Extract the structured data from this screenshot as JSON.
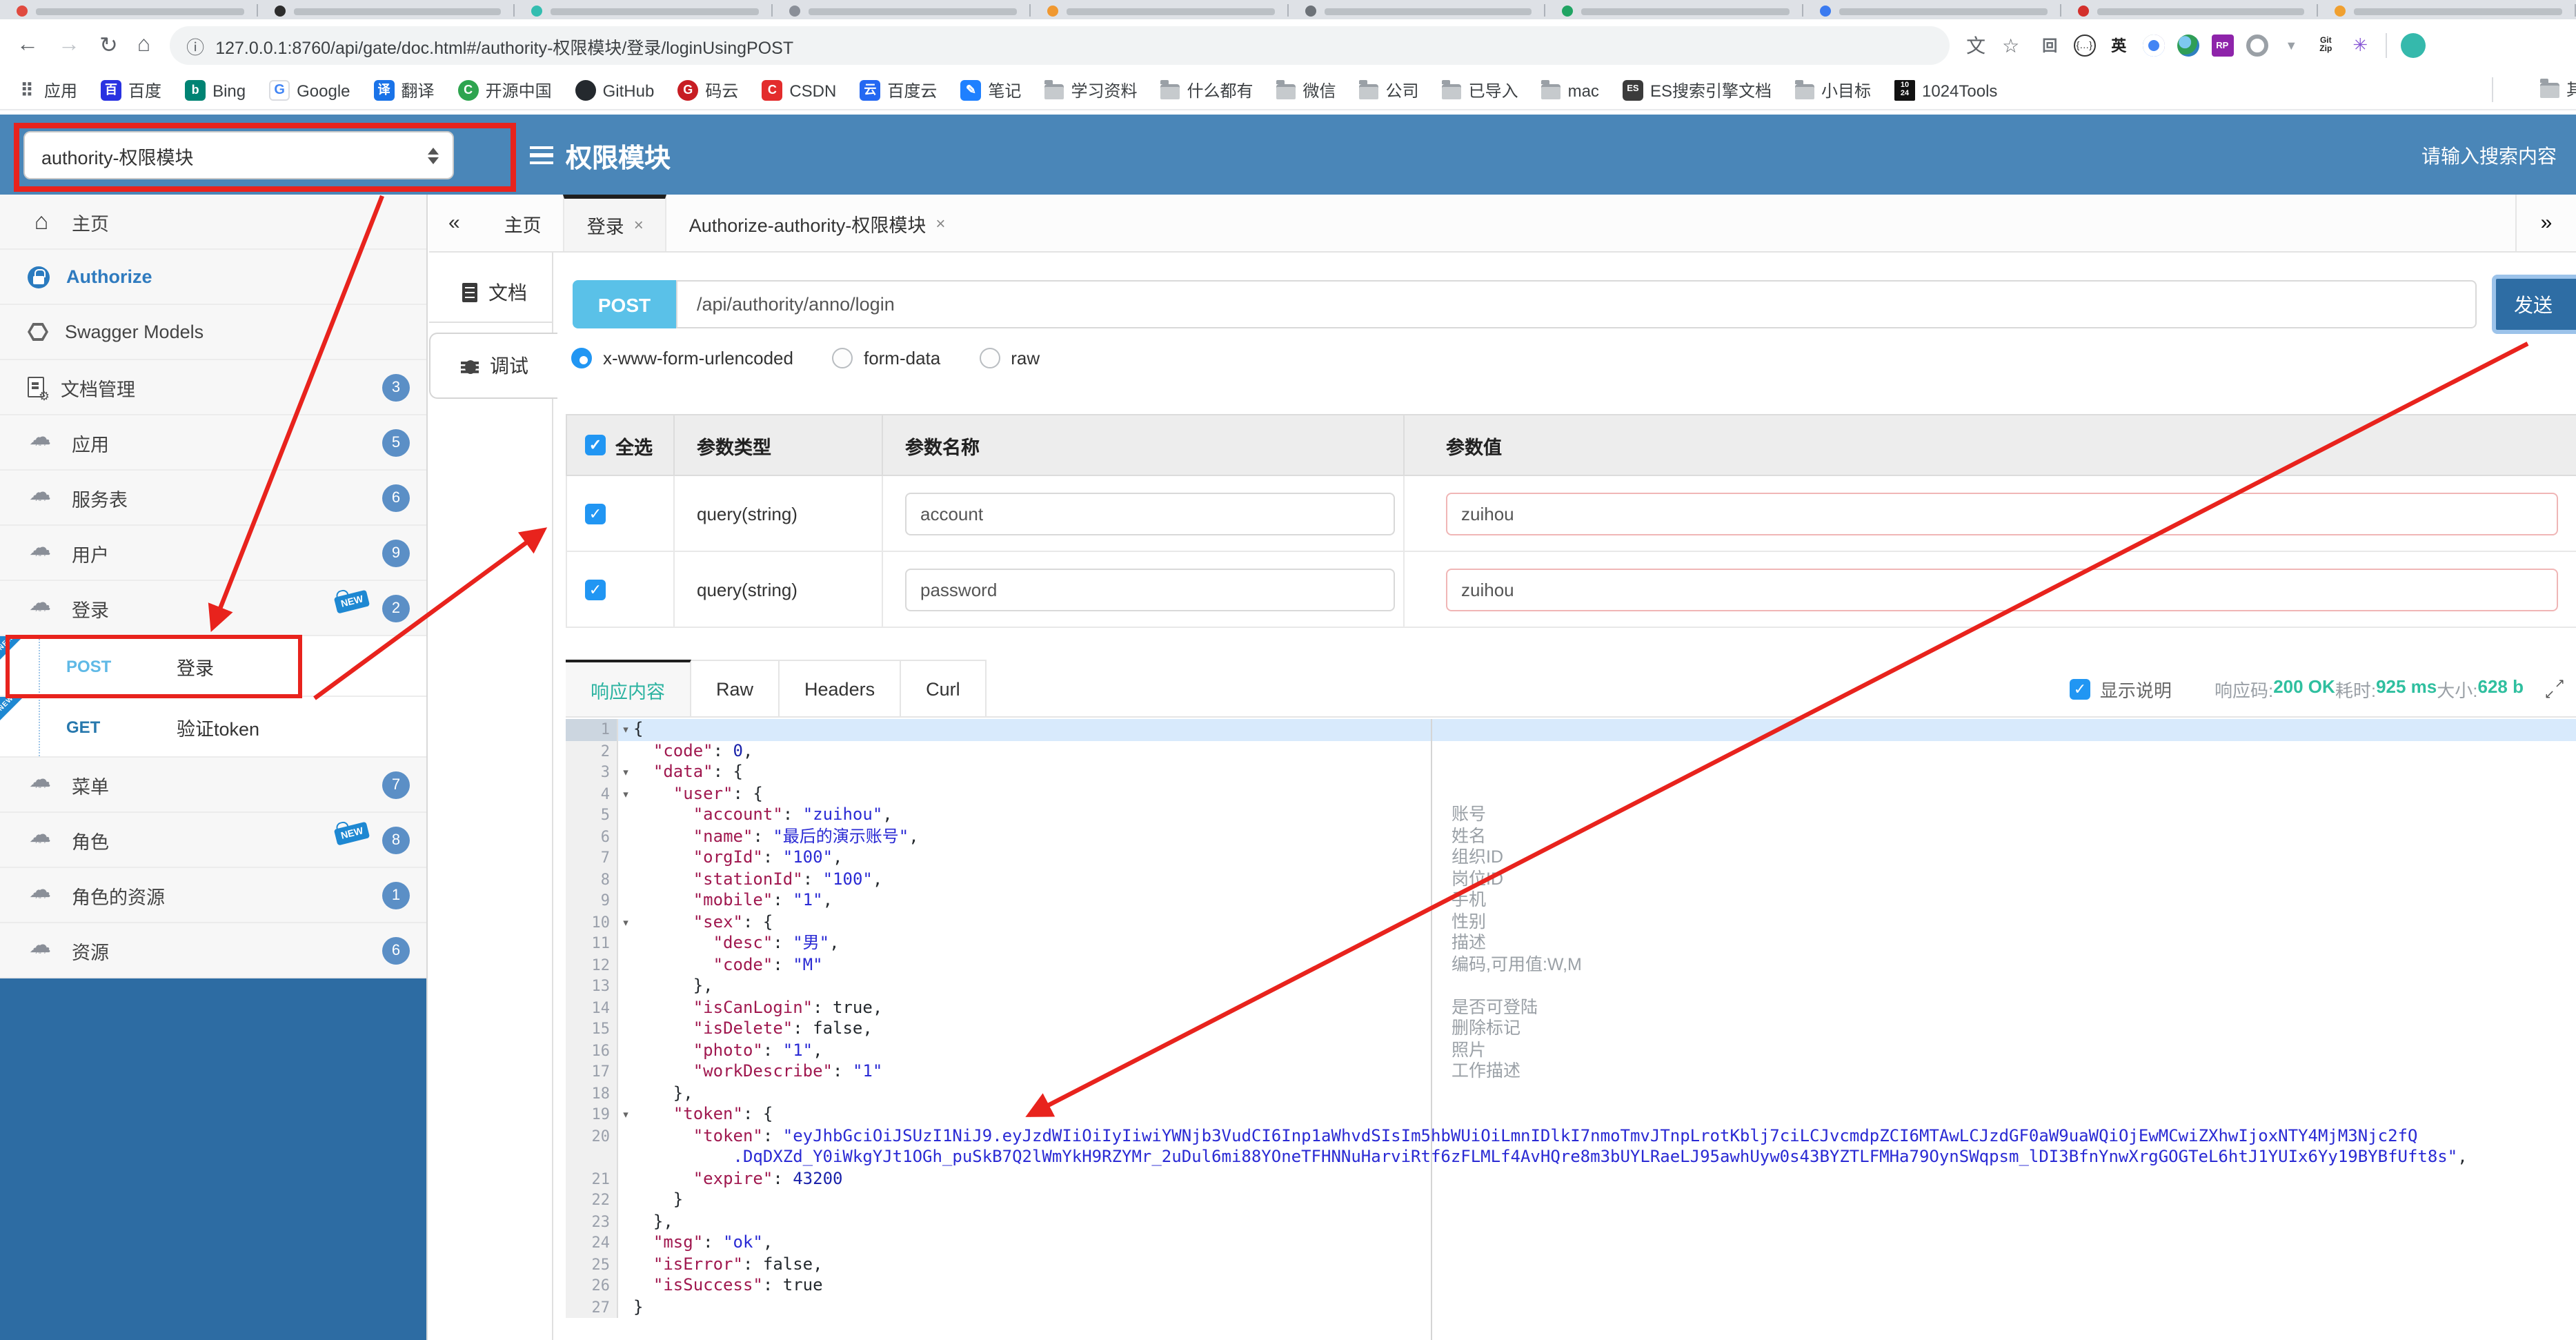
{
  "browser": {
    "tab_favicon_colors": [
      "#e04a3f",
      "#2d2d2d",
      "#33bdb0",
      "#8a8f98",
      "#f09830",
      "#6d7278",
      "#21a463",
      "#3a7af0",
      "#d3302c",
      "#f0a030"
    ],
    "url": "127.0.0.1:8760/api/gate/doc.html#/authority-权限模块/登录/loginUsingPOST",
    "bookmarks": [
      {
        "label": "应用",
        "icls": "bicon b-apps",
        "glyph": "⠿"
      },
      {
        "label": "百度",
        "icls": "bicon b-baidu",
        "glyph": "百"
      },
      {
        "label": "Bing",
        "icls": "bicon b-bing",
        "glyph": "b"
      },
      {
        "label": "Google",
        "icls": "bicon b-google",
        "glyph": "G"
      },
      {
        "label": "翻译",
        "icls": "bicon b-trans",
        "glyph": "译"
      },
      {
        "label": "开源中国",
        "icls": "bicon b-osc",
        "glyph": "C"
      },
      {
        "label": "GitHub",
        "icls": "bicon b-github",
        "glyph": ""
      },
      {
        "label": "码云",
        "icls": "bicon b-gitee",
        "glyph": "G"
      },
      {
        "label": "CSDN",
        "icls": "bicon b-csdn",
        "glyph": "C"
      },
      {
        "label": "百度云",
        "icls": "bicon b-bdy",
        "glyph": "云"
      },
      {
        "label": "笔记",
        "icls": "bicon b-note",
        "glyph": "✎"
      },
      {
        "label": "学习资料",
        "icls": "b-folder",
        "glyph": ""
      },
      {
        "label": "什么都有",
        "icls": "b-folder",
        "glyph": ""
      },
      {
        "label": "微信",
        "icls": "b-folder",
        "glyph": ""
      },
      {
        "label": "公司",
        "icls": "b-folder",
        "glyph": ""
      },
      {
        "label": "已导入",
        "icls": "b-folder",
        "glyph": ""
      },
      {
        "label": "mac",
        "icls": "b-folder",
        "glyph": ""
      },
      {
        "label": "ES搜索引擎文档",
        "icls": "bicon b-es",
        "glyph": "ES"
      },
      {
        "label": "小目标",
        "icls": "b-folder",
        "glyph": ""
      },
      {
        "label": "1024Tools",
        "icls": "bicon b-1024",
        "glyph": "10\n24"
      }
    ],
    "bookmarks_overflow": "其",
    "extensions": [
      {
        "glyph": "回",
        "style": "color:#6a6f75;font-size:11px;font-weight:bold"
      },
      {
        "glyph": "{…}",
        "style": "color:#333;font-size:7px;border:1.5px solid #333;border-radius:50%"
      },
      {
        "glyph": "英",
        "style": "color:#222;font-size:11px;font-weight:bold"
      },
      {
        "glyph": "",
        "style": "border-radius:50%;background:conic-gradient(#ea4335 0deg 120deg,#4285f4 120deg 240deg,#34a853 240deg 300deg,#fbbc05 300deg 360deg);box-shadow:inset 0 0 0 4px #fff,inset 0 0 0 8px #4285f4"
      },
      {
        "glyph": "",
        "style": "border-radius:50%;background:radial-gradient(circle at 35% 35%,#7ec8f0 0 30%,#2f9e57 31% 60%,#2f80c0 61%)"
      },
      {
        "glyph": "RP",
        "style": "background:#8e24aa;color:#fff;font-size:6.5px;font-weight:bold;border-radius:2px"
      },
      {
        "glyph": "",
        "style": "border:3px solid #9aa0a6;border-radius:50%"
      },
      {
        "glyph": "▼",
        "style": "color:#9aa0a6;font-size:9px"
      },
      {
        "glyph": "Git\nZip",
        "style": "color:#222;font-size:6px;font-weight:bold;white-space:pre;line-height:6px;text-align:center"
      },
      {
        "glyph": "✳",
        "style": "color:#8655d4;font-size:13px"
      }
    ]
  },
  "header": {
    "select_value": "authority-权限模块",
    "title": "权限模块",
    "search_placeholder": "请输入搜索内容"
  },
  "sidebar": {
    "items": [
      {
        "rowcls": "srow",
        "iconcls": "sicon i-home",
        "icon": 1,
        "label": "主页"
      },
      {
        "rowcls": "srow auth",
        "iconcls": "sicon i-lock",
        "icon": 1,
        "label": "Authorize"
      },
      {
        "rowcls": "srow",
        "iconcls": "sicon i-hex",
        "icon": 1,
        "label": "Swagger Models"
      },
      {
        "rowcls": "srow",
        "iconcls": "sicon i-docgear",
        "icon": 1,
        "label": "文档管理",
        "badge": "3"
      },
      {
        "rowcls": "srow",
        "iconcls": "sicon i-cloud",
        "icon": 1,
        "label": "应用",
        "badge": "5"
      },
      {
        "rowcls": "srow",
        "iconcls": "sicon i-cloud",
        "icon": 1,
        "label": "服务表",
        "badge": "6"
      },
      {
        "rowcls": "srow",
        "iconcls": "sicon i-cloud",
        "icon": 1,
        "label": "用户",
        "badge": "9"
      },
      {
        "rowcls": "srow",
        "iconcls": "sicon i-cloud",
        "icon": 1,
        "label": "登录",
        "badge": "2",
        "tag": "NEW"
      },
      {
        "rowcls": "srow op",
        "method": "POST",
        "mcls": "method m-post",
        "label": "登录",
        "ribbon": "NEW"
      },
      {
        "rowcls": "srow op",
        "method": "GET",
        "mcls": "method m-get",
        "label": "验证token",
        "ribbon": "NEW"
      },
      {
        "rowcls": "srow",
        "iconcls": "sicon i-cloud",
        "icon": 1,
        "label": "菜单",
        "badge": "7"
      },
      {
        "rowcls": "srow",
        "iconcls": "sicon i-cloud",
        "icon": 1,
        "label": "角色",
        "badge": "8",
        "tag": "NEW"
      },
      {
        "rowcls": "srow",
        "iconcls": "sicon i-cloud",
        "icon": 1,
        "label": "角色的资源",
        "badge": "1"
      },
      {
        "rowcls": "srow",
        "iconcls": "sicon i-cloud",
        "icon": 1,
        "label": "资源",
        "badge": "6"
      }
    ]
  },
  "main_tabs": {
    "collapse": "«",
    "expand": "»",
    "items": [
      {
        "cls": "atab",
        "label": "主页"
      },
      {
        "cls": "atab active",
        "label": "登录",
        "close": "×"
      },
      {
        "cls": "atab",
        "label": "Authorize-authority-权限模块",
        "close": "×"
      }
    ]
  },
  "panel_tabs": {
    "doc": "文档",
    "debug": "调试"
  },
  "request": {
    "method": "POST",
    "url": "/api/authority/anno/login",
    "send_label": "发送",
    "body_types": [
      {
        "label": "x-www-form-urlencoded",
        "selected": 1
      },
      {
        "label": "form-data"
      },
      {
        "label": "raw"
      }
    ]
  },
  "params": {
    "select_all": "全选",
    "col_type": "参数类型",
    "col_name": "参数名称",
    "col_value": "参数值",
    "rows": [
      {
        "type": "query(string)",
        "name": "account",
        "value": "zuihou"
      },
      {
        "type": "query(string)",
        "name": "password",
        "value": "zuihou"
      }
    ]
  },
  "response": {
    "tabs": [
      {
        "cls": "rtab active",
        "label": "响应内容"
      },
      {
        "cls": "rtab",
        "label": "Raw"
      },
      {
        "cls": "rtab",
        "label": "Headers"
      },
      {
        "cls": "rtab",
        "label": "Curl"
      }
    ],
    "show_desc": "显示说明",
    "status": [
      {
        "label": "响应码:",
        "value": "200 OK"
      },
      {
        "label": "耗时:",
        "value": "925 ms"
      },
      {
        "label": "大小:",
        "value": "628 b"
      }
    ],
    "code_rows": [
      {
        "n": "1",
        "fold": 1,
        "hl": 1,
        "seg": [
          [
            "p",
            "{"
          ]
        ]
      },
      {
        "n": "2",
        "seg": [
          [
            "p",
            "  "
          ],
          [
            "k",
            "\"code\""
          ],
          [
            "p",
            ": "
          ],
          [
            "n",
            "0"
          ],
          [
            "p",
            ","
          ]
        ]
      },
      {
        "n": "3",
        "fold": 1,
        "seg": [
          [
            "p",
            "  "
          ],
          [
            "k",
            "\"data\""
          ],
          [
            "p",
            ": {"
          ]
        ]
      },
      {
        "n": "4",
        "fold": 1,
        "seg": [
          [
            "p",
            "    "
          ],
          [
            "k",
            "\"user\""
          ],
          [
            "p",
            ": {"
          ]
        ]
      },
      {
        "n": "5",
        "seg": [
          [
            "p",
            "      "
          ],
          [
            "k",
            "\"account\""
          ],
          [
            "p",
            ": "
          ],
          [
            "s",
            "\"zuihou\""
          ],
          [
            "p",
            ","
          ]
        ]
      },
      {
        "n": "6",
        "seg": [
          [
            "p",
            "      "
          ],
          [
            "k",
            "\"name\""
          ],
          [
            "p",
            ": "
          ],
          [
            "s",
            "\"最后的演示账号\""
          ],
          [
            "p",
            ","
          ]
        ]
      },
      {
        "n": "7",
        "seg": [
          [
            "p",
            "      "
          ],
          [
            "k",
            "\"orgId\""
          ],
          [
            "p",
            ": "
          ],
          [
            "s",
            "\"100\""
          ],
          [
            "p",
            ","
          ]
        ]
      },
      {
        "n": "8",
        "seg": [
          [
            "p",
            "      "
          ],
          [
            "k",
            "\"stationId\""
          ],
          [
            "p",
            ": "
          ],
          [
            "s",
            "\"100\""
          ],
          [
            "p",
            ","
          ]
        ]
      },
      {
        "n": "9",
        "seg": [
          [
            "p",
            "      "
          ],
          [
            "k",
            "\"mobile\""
          ],
          [
            "p",
            ": "
          ],
          [
            "s",
            "\"1\""
          ],
          [
            "p",
            ","
          ]
        ]
      },
      {
        "n": "10",
        "fold": 1,
        "seg": [
          [
            "p",
            "      "
          ],
          [
            "k",
            "\"sex\""
          ],
          [
            "p",
            ": {"
          ]
        ]
      },
      {
        "n": "11",
        "seg": [
          [
            "p",
            "        "
          ],
          [
            "k",
            "\"desc\""
          ],
          [
            "p",
            ": "
          ],
          [
            "s",
            "\"男\""
          ],
          [
            "p",
            ","
          ]
        ]
      },
      {
        "n": "12",
        "seg": [
          [
            "p",
            "        "
          ],
          [
            "k",
            "\"code\""
          ],
          [
            "p",
            ": "
          ],
          [
            "s",
            "\"M\""
          ]
        ]
      },
      {
        "n": "13",
        "seg": [
          [
            "p",
            "      },"
          ]
        ]
      },
      {
        "n": "14",
        "seg": [
          [
            "p",
            "      "
          ],
          [
            "k",
            "\"isCanLogin\""
          ],
          [
            "p",
            ": "
          ],
          [
            "b",
            "true"
          ],
          [
            "p",
            ","
          ]
        ]
      },
      {
        "n": "15",
        "seg": [
          [
            "p",
            "      "
          ],
          [
            "k",
            "\"isDelete\""
          ],
          [
            "p",
            ": "
          ],
          [
            "b",
            "false"
          ],
          [
            "p",
            ","
          ]
        ]
      },
      {
        "n": "16",
        "seg": [
          [
            "p",
            "      "
          ],
          [
            "k",
            "\"photo\""
          ],
          [
            "p",
            ": "
          ],
          [
            "s",
            "\"1\""
          ],
          [
            "p",
            ","
          ]
        ]
      },
      {
        "n": "17",
        "seg": [
          [
            "p",
            "      "
          ],
          [
            "k",
            "\"workDescribe\""
          ],
          [
            "p",
            ": "
          ],
          [
            "s",
            "\"1\""
          ]
        ]
      },
      {
        "n": "18",
        "seg": [
          [
            "p",
            "    },"
          ]
        ]
      },
      {
        "n": "19",
        "fold": 1,
        "seg": [
          [
            "p",
            "    "
          ],
          [
            "k",
            "\"token\""
          ],
          [
            "p",
            ": {"
          ]
        ]
      },
      {
        "n": "20",
        "seg": [
          [
            "p",
            "      "
          ],
          [
            "k",
            "\"token\""
          ],
          [
            "p",
            ": "
          ],
          [
            "s",
            "\"eyJhbGciOiJSUzI1NiJ9.eyJzdWIiOiIyIiwiYWNjb3VudCI6Inp1aWhvdSIsIm5hbWUiOiLmnIDlkI7nmoTmvJTnpLrotKblj7ciLCJvcmdpZCI6MTAwLCJzdGF0aW9uaWQiOjEwMCwiZXhwIjoxNTY4MjM3Njc2fQ"
          ]
        ]
      },
      {
        "n": "",
        "seg": [
          [
            "s",
            "          .DqDXZd_Y0iWkgYJt1OGh_puSkB7Q2lWmYkH9RZYMr_2uDul6mi88YOneTFHNNuHarviRtf6zFLMLf4AvHQre8m3bUYLRaeLJ95awhUyw0s43BYZTLFMHa79OynSWqpsm_lDI3BfnYnwXrgGOGTeL6htJ1YUIx6Yy19BYBfUft8s\""
          ],
          [
            "p",
            ","
          ]
        ]
      },
      {
        "n": "21",
        "seg": [
          [
            "p",
            "      "
          ],
          [
            "k",
            "\"expire\""
          ],
          [
            "p",
            ": "
          ],
          [
            "n",
            "43200"
          ]
        ]
      },
      {
        "n": "22",
        "seg": [
          [
            "p",
            "    }"
          ]
        ]
      },
      {
        "n": "23",
        "seg": [
          [
            "p",
            "  },"
          ]
        ]
      },
      {
        "n": "24",
        "seg": [
          [
            "p",
            "  "
          ],
          [
            "k",
            "\"msg\""
          ],
          [
            "p",
            ": "
          ],
          [
            "s",
            "\"ok\""
          ],
          [
            "p",
            ","
          ]
        ]
      },
      {
        "n": "25",
        "seg": [
          [
            "p",
            "  "
          ],
          [
            "k",
            "\"isError\""
          ],
          [
            "p",
            ": "
          ],
          [
            "b",
            "false"
          ],
          [
            "p",
            ","
          ]
        ]
      },
      {
        "n": "26",
        "seg": [
          [
            "p",
            "  "
          ],
          [
            "k",
            "\"isSuccess\""
          ],
          [
            "p",
            ": "
          ],
          [
            "b",
            "true"
          ]
        ]
      },
      {
        "n": "27",
        "seg": [
          [
            "p",
            "}"
          ]
        ]
      }
    ],
    "annotations": [
      {
        "line": 5,
        "text": "账号"
      },
      {
        "line": 6,
        "text": "姓名"
      },
      {
        "line": 7,
        "text": "组织ID"
      },
      {
        "line": 8,
        "text": "岗位ID"
      },
      {
        "line": 9,
        "text": "手机"
      },
      {
        "line": 10,
        "text": "性别"
      },
      {
        "line": 11,
        "text": "描述"
      },
      {
        "line": 12,
        "text": "编码,可用值:W,M"
      },
      {
        "line": 14,
        "text": "是否可登陆"
      },
      {
        "line": 15,
        "text": "删除标记"
      },
      {
        "line": 16,
        "text": "照片"
      },
      {
        "line": 17,
        "text": "工作描述"
      }
    ]
  }
}
